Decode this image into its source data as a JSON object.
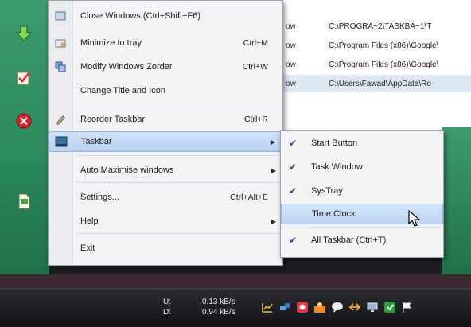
{
  "window_rows": [
    {
      "col1": "ow",
      "col2": "C:\\PROGRA~2\\TASKBA~1\\T"
    },
    {
      "col1": "ow",
      "col2": "C:\\Program Files (x86)\\Google\\"
    },
    {
      "col1": "ow",
      "col2": "C:\\Program Files (x86)\\Google\\"
    },
    {
      "col1": "ow",
      "col2": "C:\\Users\\Fawad\\AppData\\Ro"
    }
  ],
  "main_menu": {
    "items": [
      {
        "label": "Close Windows (Ctrl+Shift+F6)",
        "shortcut": ""
      },
      {
        "label": "Minimize to tray",
        "shortcut": "Ctrl+M"
      },
      {
        "label": "Modify Windows Zorder",
        "shortcut": "Ctrl+W"
      },
      {
        "label": "Change Title and Icon",
        "shortcut": ""
      },
      {
        "label": "Reorder Taskbar",
        "shortcut": "Ctrl+R"
      },
      {
        "label": "Taskbar",
        "shortcut": ""
      },
      {
        "label": "Auto Maximise windows",
        "shortcut": ""
      },
      {
        "label": "Settings...",
        "shortcut": "Ctrl+Alt+E"
      },
      {
        "label": "Help",
        "shortcut": ""
      },
      {
        "label": "Exit",
        "shortcut": ""
      }
    ]
  },
  "taskbar_submenu": {
    "items": [
      {
        "label": "Start Button",
        "checked": true
      },
      {
        "label": "Task Window",
        "checked": true
      },
      {
        "label": "SysTray",
        "checked": true
      },
      {
        "label": "Time Clock",
        "checked": false
      },
      {
        "label": "All Taskbar (Ctrl+T)",
        "checked": true
      }
    ]
  },
  "taskbar": {
    "net_up_label": "U:",
    "net_down_label": "D:",
    "net_up_value": "0.13 kB/s",
    "net_down_value": "0.94 kB/s"
  },
  "colors": {
    "menu_highlight": "#b9d3f2",
    "desktop_green": "#2c8a5c",
    "checkmark": "#2b4f86"
  }
}
